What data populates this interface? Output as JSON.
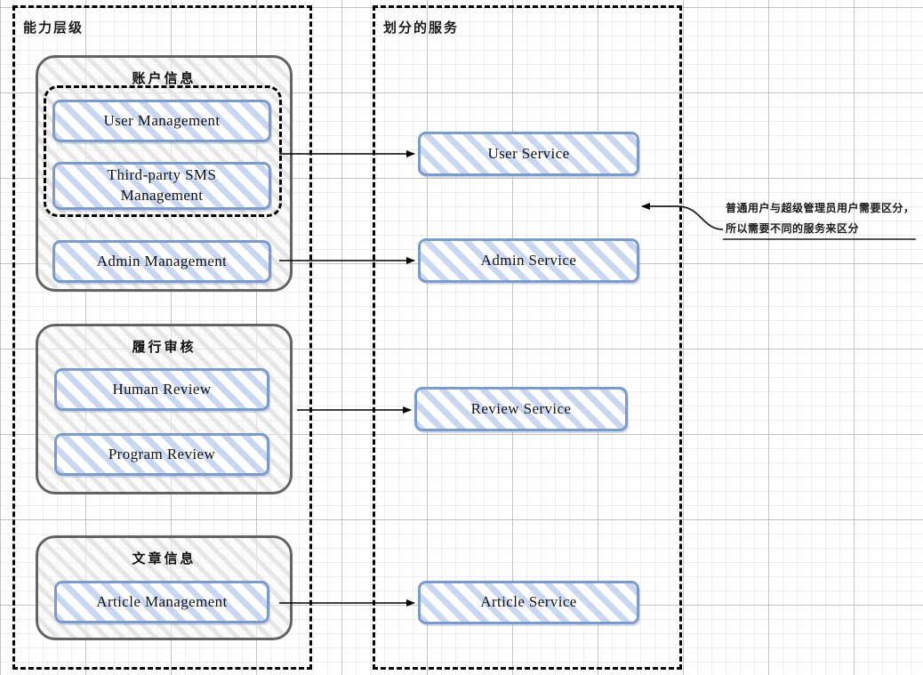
{
  "lanes": [
    {
      "title": "能力层级"
    },
    {
      "title": "划分的服务"
    }
  ],
  "capability_groups": [
    {
      "title": "账户信息",
      "subgroup": {
        "style": "dashed"
      },
      "items": [
        {
          "label": "User  Management"
        },
        {
          "label": "Third-party SMS\nManagement"
        },
        {
          "label": "Admin  Management"
        }
      ]
    },
    {
      "title": "履行审核",
      "items": [
        {
          "label": "Human Review"
        },
        {
          "label": "Program Review"
        }
      ]
    },
    {
      "title": "文章信息",
      "items": [
        {
          "label": "Article  Management"
        }
      ]
    }
  ],
  "services": [
    {
      "label": "User  Service"
    },
    {
      "label": "Admin  Service"
    },
    {
      "label": "Review  Service"
    },
    {
      "label": "Article  Service"
    }
  ],
  "annotation": {
    "text": "普通用户与超级管理员用户需要区分，所以需要不同的服务来区分"
  },
  "colors": {
    "box_border": "#7d9bc9",
    "box_hatch": "#c9d8f0",
    "group_border": "#636363",
    "lane_border": "#000000",
    "arrow": "#000000",
    "text": "#111111"
  }
}
